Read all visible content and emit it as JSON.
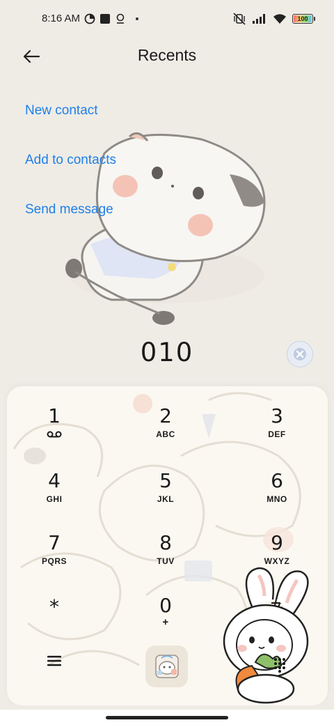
{
  "status_bar": {
    "time": "8:16 AM",
    "battery": "100",
    "icons": [
      "data-saver-icon",
      "square-notification-icon",
      "location-icon",
      "dot-icon",
      "mute-vibrate-icon",
      "signal-icon",
      "wifi-icon",
      "battery-icon"
    ]
  },
  "header": {
    "title": "Recents",
    "back_icon": "arrow-left-icon"
  },
  "actions": {
    "new_contact": "New contact",
    "add_to_contacts": "Add to contacts",
    "send_message": "Send message"
  },
  "dialer": {
    "number": "010",
    "backspace_icon": "backspace-icon"
  },
  "keypad": {
    "keys": [
      {
        "digit": "1",
        "letters": ""
      },
      {
        "digit": "2",
        "letters": "ABC"
      },
      {
        "digit": "3",
        "letters": "DEF"
      },
      {
        "digit": "4",
        "letters": "GHI"
      },
      {
        "digit": "5",
        "letters": "JKL"
      },
      {
        "digit": "6",
        "letters": "MNO"
      },
      {
        "digit": "7",
        "letters": "PQRS"
      },
      {
        "digit": "8",
        "letters": "TUV"
      },
      {
        "digit": "9",
        "letters": "WXYZ"
      },
      {
        "digit": "*",
        "letters": ""
      },
      {
        "digit": "0",
        "letters": "+"
      },
      {
        "digit": "#",
        "letters": ""
      }
    ],
    "menu_icon": "hamburger-menu-icon",
    "call_icon": "call-sticker-icon",
    "dialpad_icon": "dialpad-grid-icon"
  },
  "colors": {
    "background": "#efece6",
    "link": "#1f7fe6",
    "keypad": "#fbf8f1"
  }
}
